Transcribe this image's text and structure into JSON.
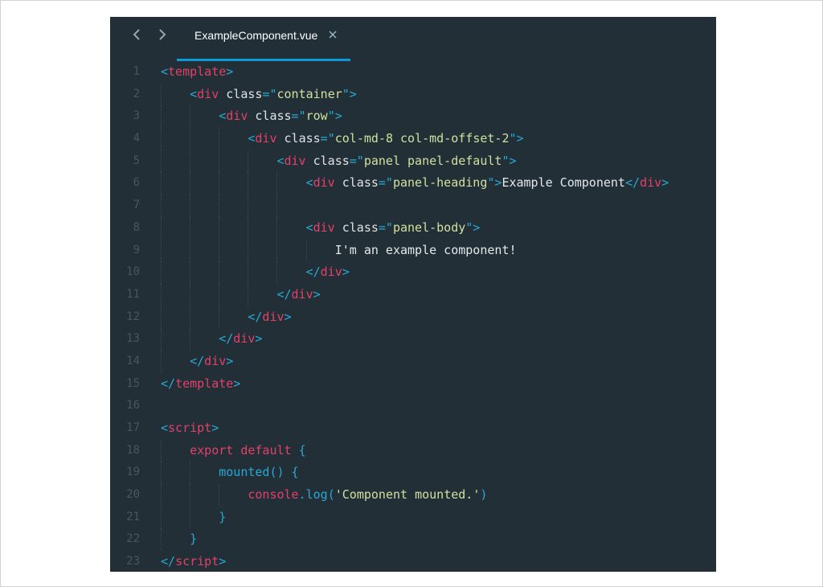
{
  "editor": {
    "tab": {
      "label": "ExampleComponent.vue"
    },
    "colors": {
      "background": "#232f36",
      "accent": "#0d9bd4",
      "tag": "#e3406a",
      "punctuation": "#27a9d6",
      "string": "#cfe0a0",
      "text": "#dfe3e6",
      "gutter": "#4a565d"
    },
    "icons": {
      "back": "chevron-left-icon",
      "forward": "chevron-right-icon",
      "close": "close-icon"
    },
    "lines": [
      {
        "number": "1",
        "indent": 0,
        "tokens": [
          [
            "punc",
            "<"
          ],
          [
            "tag",
            "template"
          ],
          [
            "punc",
            ">"
          ]
        ]
      },
      {
        "number": "2",
        "indent": 1,
        "tokens": [
          [
            "punc",
            "<"
          ],
          [
            "tag",
            "div"
          ],
          [
            "attr",
            " class"
          ],
          [
            "punc",
            "=\""
          ],
          [
            "str",
            "container"
          ],
          [
            "punc",
            "\">"
          ]
        ]
      },
      {
        "number": "3",
        "indent": 2,
        "tokens": [
          [
            "punc",
            "<"
          ],
          [
            "tag",
            "div"
          ],
          [
            "attr",
            " class"
          ],
          [
            "punc",
            "=\""
          ],
          [
            "str",
            "row"
          ],
          [
            "punc",
            "\">"
          ]
        ]
      },
      {
        "number": "4",
        "indent": 3,
        "tokens": [
          [
            "punc",
            "<"
          ],
          [
            "tag",
            "div"
          ],
          [
            "attr",
            " class"
          ],
          [
            "punc",
            "=\""
          ],
          [
            "str",
            "col-md-8 col-md-offset-2"
          ],
          [
            "punc",
            "\">"
          ]
        ]
      },
      {
        "number": "5",
        "indent": 4,
        "tokens": [
          [
            "punc",
            "<"
          ],
          [
            "tag",
            "div"
          ],
          [
            "attr",
            " class"
          ],
          [
            "punc",
            "=\""
          ],
          [
            "str",
            "panel panel-default"
          ],
          [
            "punc",
            "\">"
          ]
        ]
      },
      {
        "number": "6",
        "indent": 5,
        "tokens": [
          [
            "punc",
            "<"
          ],
          [
            "tag",
            "div"
          ],
          [
            "attr",
            " class"
          ],
          [
            "punc",
            "=\""
          ],
          [
            "str",
            "panel-heading"
          ],
          [
            "punc",
            "\">"
          ],
          [
            "text",
            "Example Component"
          ],
          [
            "punc",
            "</"
          ],
          [
            "tag",
            "div"
          ],
          [
            "punc",
            ">"
          ]
        ]
      },
      {
        "number": "7",
        "indent": 5,
        "tokens": []
      },
      {
        "number": "8",
        "indent": 5,
        "tokens": [
          [
            "punc",
            "<"
          ],
          [
            "tag",
            "div"
          ],
          [
            "attr",
            " class"
          ],
          [
            "punc",
            "=\""
          ],
          [
            "str",
            "panel-body"
          ],
          [
            "punc",
            "\">"
          ]
        ]
      },
      {
        "number": "9",
        "indent": 6,
        "tokens": [
          [
            "text",
            "I'm an example component!"
          ]
        ]
      },
      {
        "number": "10",
        "indent": 5,
        "tokens": [
          [
            "punc",
            "</"
          ],
          [
            "tag",
            "div"
          ],
          [
            "punc",
            ">"
          ]
        ]
      },
      {
        "number": "11",
        "indent": 4,
        "tokens": [
          [
            "punc",
            "</"
          ],
          [
            "tag",
            "div"
          ],
          [
            "punc",
            ">"
          ]
        ]
      },
      {
        "number": "12",
        "indent": 3,
        "tokens": [
          [
            "punc",
            "</"
          ],
          [
            "tag",
            "div"
          ],
          [
            "punc",
            ">"
          ]
        ]
      },
      {
        "number": "13",
        "indent": 2,
        "tokens": [
          [
            "punc",
            "</"
          ],
          [
            "tag",
            "div"
          ],
          [
            "punc",
            ">"
          ]
        ]
      },
      {
        "number": "14",
        "indent": 1,
        "tokens": [
          [
            "punc",
            "</"
          ],
          [
            "tag",
            "div"
          ],
          [
            "punc",
            ">"
          ]
        ]
      },
      {
        "number": "15",
        "indent": 0,
        "tokens": [
          [
            "punc",
            "</"
          ],
          [
            "tag",
            "template"
          ],
          [
            "punc",
            ">"
          ]
        ]
      },
      {
        "number": "16",
        "indent": 0,
        "tokens": []
      },
      {
        "number": "17",
        "indent": 0,
        "tokens": [
          [
            "punc",
            "<"
          ],
          [
            "tag",
            "script"
          ],
          [
            "punc",
            ">"
          ]
        ]
      },
      {
        "number": "18",
        "indent": 1,
        "tokens": [
          [
            "kw",
            "export"
          ],
          [
            "text",
            " "
          ],
          [
            "kw",
            "default"
          ],
          [
            "text",
            " "
          ],
          [
            "punc",
            "{"
          ]
        ]
      },
      {
        "number": "19",
        "indent": 2,
        "tokens": [
          [
            "fn",
            "mounted"
          ],
          [
            "punc",
            "() {"
          ]
        ]
      },
      {
        "number": "20",
        "indent": 3,
        "tokens": [
          [
            "id",
            "console"
          ],
          [
            "punc",
            "."
          ],
          [
            "fn",
            "log"
          ],
          [
            "punc",
            "("
          ],
          [
            "str",
            "'Component mounted.'"
          ],
          [
            "punc",
            ")"
          ]
        ]
      },
      {
        "number": "21",
        "indent": 2,
        "tokens": [
          [
            "punc",
            "}"
          ]
        ]
      },
      {
        "number": "22",
        "indent": 1,
        "tokens": [
          [
            "punc",
            "}"
          ]
        ]
      },
      {
        "number": "23",
        "indent": 0,
        "tokens": [
          [
            "punc",
            "</"
          ],
          [
            "tag",
            "script"
          ],
          [
            "punc",
            ">"
          ]
        ]
      }
    ]
  }
}
